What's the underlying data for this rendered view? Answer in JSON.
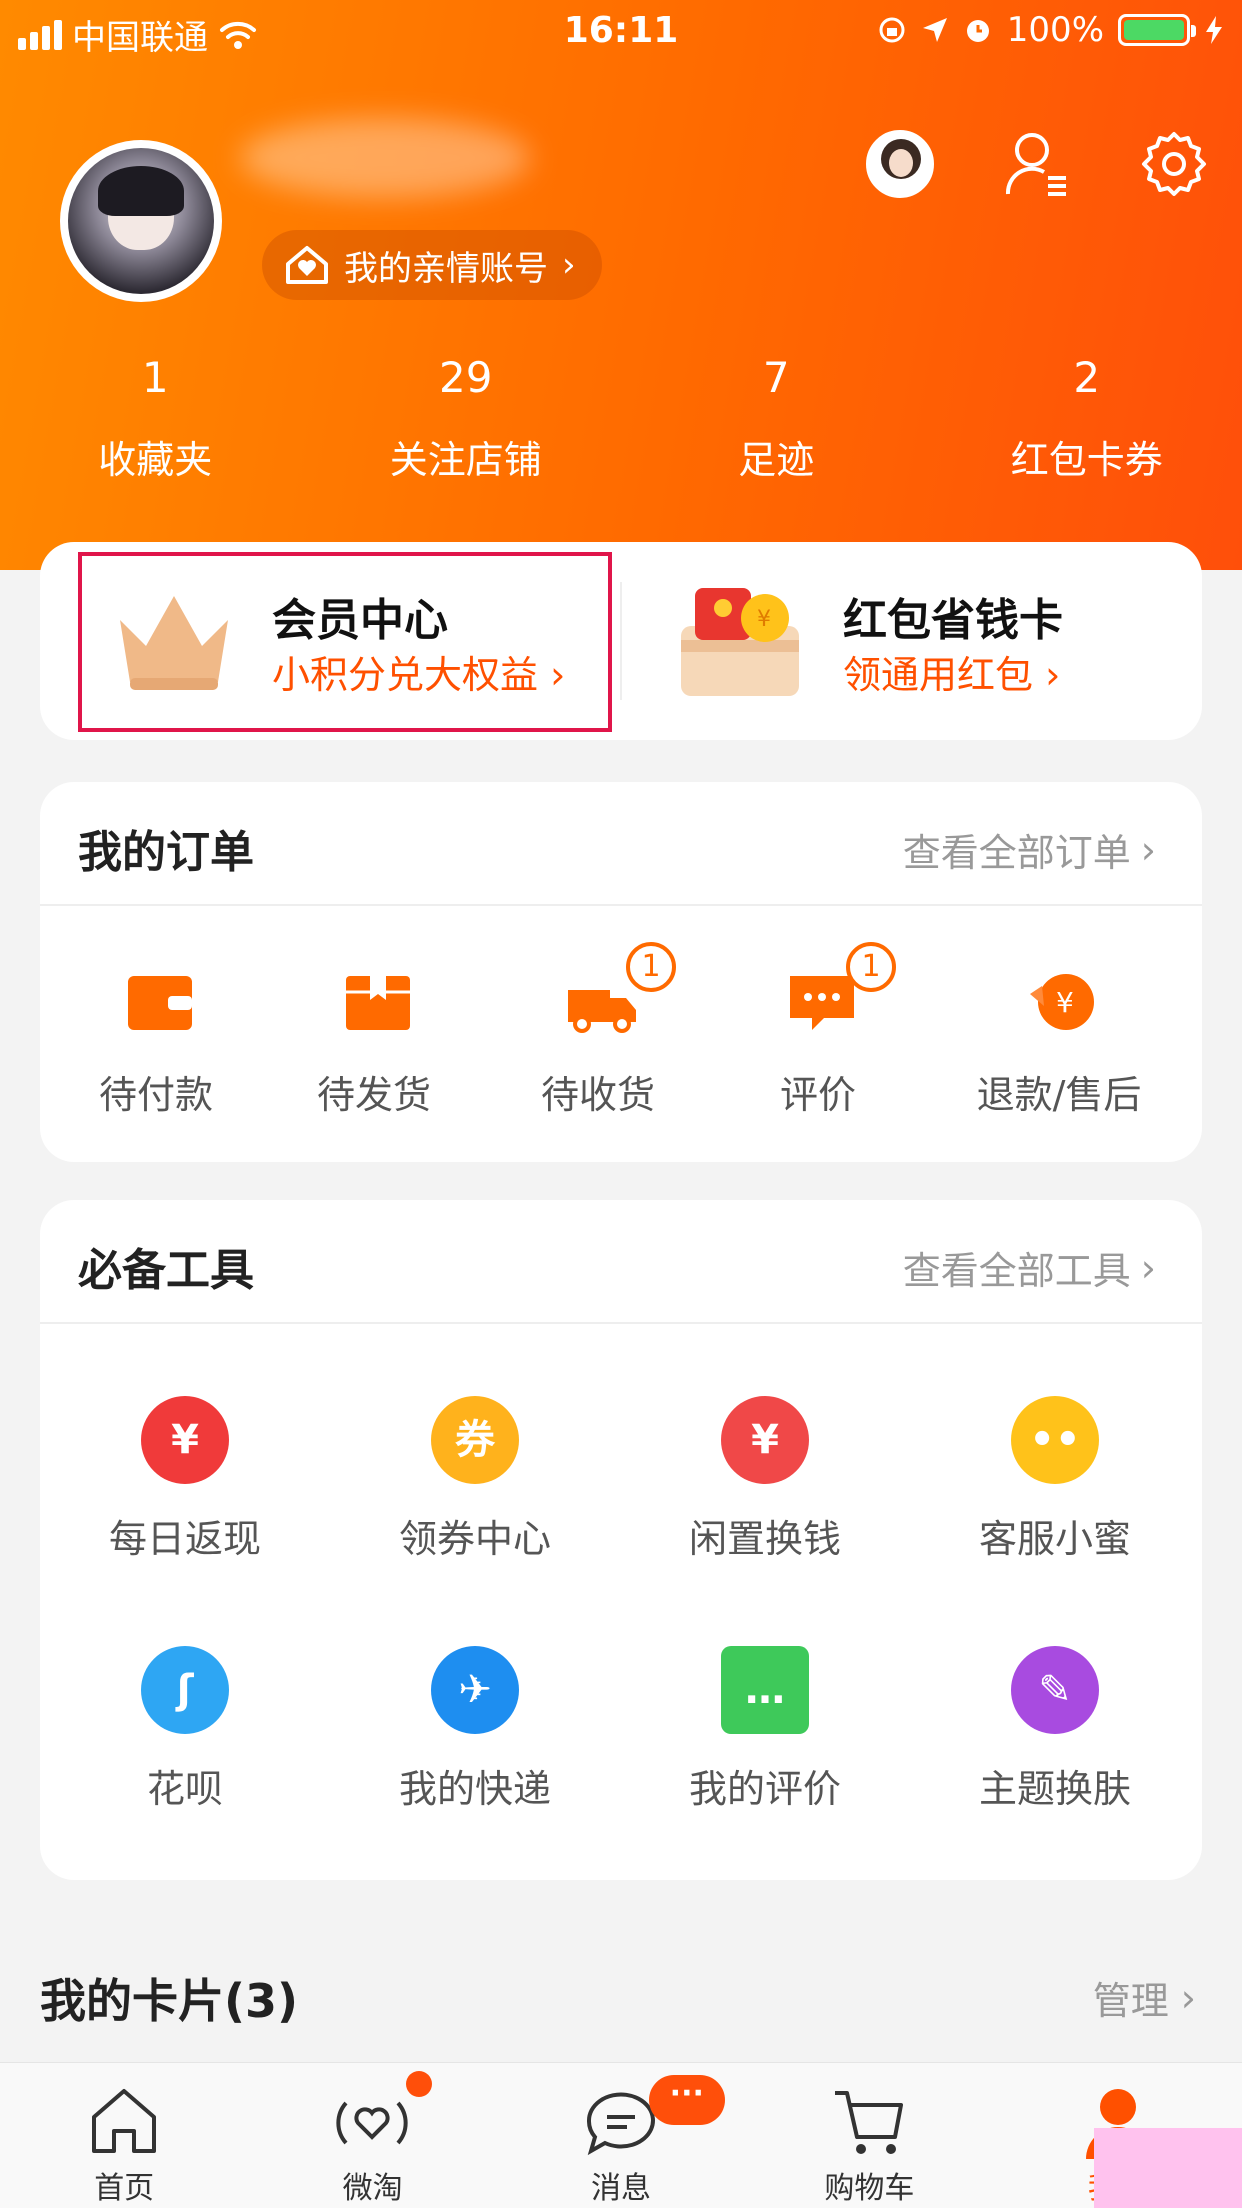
{
  "status_bar": {
    "carrier": "中国联通",
    "time": "16:11",
    "battery_percent": "100%",
    "icons": [
      "signal-icon",
      "wifi-icon",
      "orientation-lock-icon",
      "location-icon",
      "alarm-icon",
      "battery-icon",
      "charging-icon"
    ]
  },
  "header": {
    "family_account_label": "我的亲情账号",
    "icons": [
      "user-avatar-icon",
      "contacts-icon",
      "settings-gear-icon"
    ],
    "stats": [
      {
        "value": "1",
        "label": "收藏夹"
      },
      {
        "value": "29",
        "label": "关注店铺"
      },
      {
        "value": "7",
        "label": "足迹"
      },
      {
        "value": "2",
        "label": "红包卡券"
      }
    ]
  },
  "promo": {
    "member": {
      "title": "会员中心",
      "subtitle": "小积分兑大权益 ›"
    },
    "savings": {
      "title": "红包省钱卡",
      "subtitle": "领通用红包 ›"
    }
  },
  "orders": {
    "title": "我的订单",
    "more": "查看全部订单",
    "items": [
      {
        "label": "待付款",
        "icon": "wallet-icon",
        "badge": ""
      },
      {
        "label": "待发货",
        "icon": "package-icon",
        "badge": ""
      },
      {
        "label": "待收货",
        "icon": "truck-icon",
        "badge": "1"
      },
      {
        "label": "评价",
        "icon": "comment-icon",
        "badge": "1"
      },
      {
        "label": "退款/售后",
        "icon": "refund-icon",
        "badge": ""
      }
    ]
  },
  "tools": {
    "title": "必备工具",
    "more": "查看全部工具",
    "items": [
      {
        "label": "每日返现",
        "icon": "calendar-cashback-icon",
        "glyph": "¥",
        "color": "#f03a3a"
      },
      {
        "label": "领券中心",
        "icon": "coupon-icon",
        "glyph": "券",
        "color": "#ffb21c"
      },
      {
        "label": "闲置换钱",
        "icon": "money-bag-icon",
        "glyph": "¥",
        "color": "#f04848"
      },
      {
        "label": "客服小蜜",
        "icon": "service-bot-icon",
        "glyph": "••",
        "color": "#ffc21a"
      },
      {
        "label": "花呗",
        "icon": "huabei-icon",
        "glyph": "ʃ",
        "color": "#2ea6f3"
      },
      {
        "label": "我的快递",
        "icon": "express-bird-icon",
        "glyph": "✈",
        "color": "#1e8ef0"
      },
      {
        "label": "我的评价",
        "icon": "review-chat-icon",
        "glyph": "…",
        "color": "#3ec95a"
      },
      {
        "label": "主题换肤",
        "icon": "theme-palette-icon",
        "glyph": "✎",
        "color": "#a84be0"
      }
    ]
  },
  "cards": {
    "title": "我的卡片(3)",
    "manage": "管理"
  },
  "tabbar": {
    "items": [
      {
        "label": "首页",
        "icon": "home-icon"
      },
      {
        "label": "微淘",
        "icon": "weitao-icon"
      },
      {
        "label": "消息",
        "icon": "message-icon",
        "bubble": "···"
      },
      {
        "label": "购物车",
        "icon": "cart-icon"
      },
      {
        "label": "我的",
        "icon": "profile-icon"
      }
    ]
  },
  "colors": {
    "accent": "#ff5000",
    "header_start": "#ff8a00",
    "header_end": "#ff4f0a",
    "highlight_border": "#e0154a"
  }
}
